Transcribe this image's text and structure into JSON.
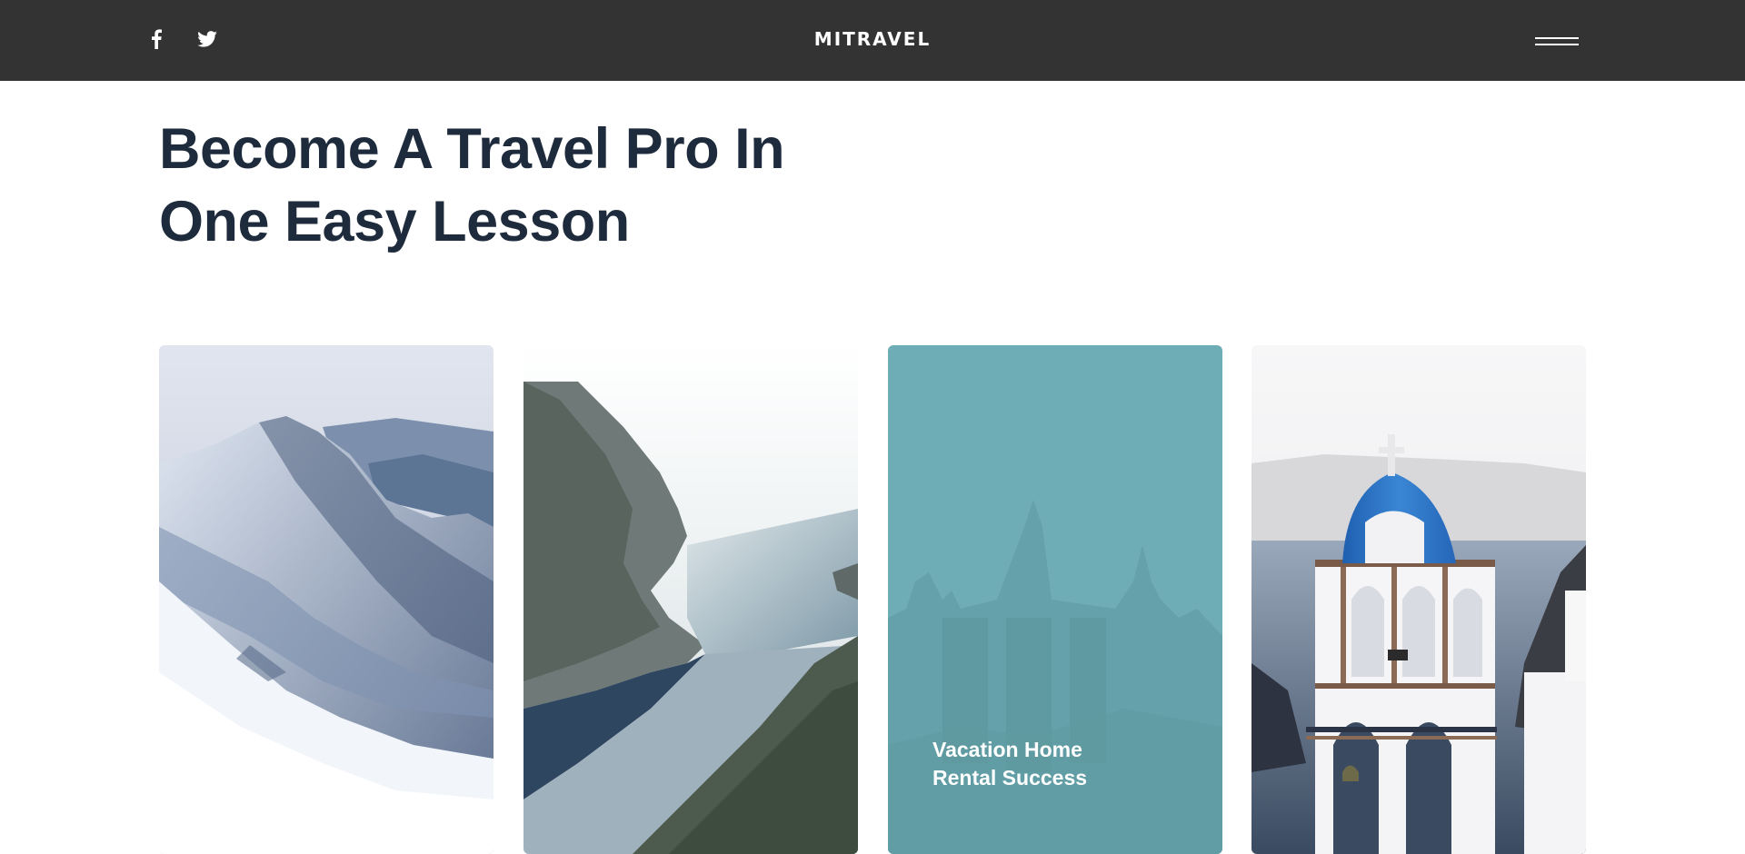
{
  "header": {
    "brand": "MITRAVEL",
    "social": [
      {
        "icon": "facebook-icon"
      },
      {
        "icon": "twitter-icon"
      }
    ],
    "menu_icon": "hamburger-menu-icon",
    "background": "#333333"
  },
  "hero": {
    "title_line1": "Become A Travel Pro In",
    "title_line2": "One Easy Lesson",
    "color": "#1e2b3c"
  },
  "cards": [
    {
      "image": "snowy-mountain-peak"
    },
    {
      "image": "fjord-cliffs-river"
    },
    {
      "image": "castle-in-fog",
      "title_line1": "Vacation Home",
      "title_line2": "Rental Success",
      "overlay": "#6fadb6"
    },
    {
      "image": "white-bell-tower-blue-dome"
    }
  ]
}
